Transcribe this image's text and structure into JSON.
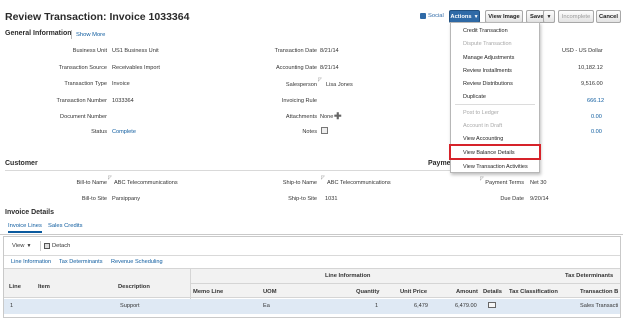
{
  "page": {
    "title": "Review Transaction: Invoice 1033364"
  },
  "header": {
    "social": "Social",
    "actions": "Actions",
    "view_image": "View Image",
    "save": "Save",
    "incomplete": "Incomplete",
    "cancel": "Cancel"
  },
  "general": {
    "title": "General Information",
    "show_more": "Show More",
    "business_unit_label": "Business Unit",
    "business_unit_value": "US1 Business Unit",
    "transaction_source_label": "Transaction Source",
    "transaction_source_value": "Receivables Import",
    "transaction_type_label": "Transaction Type",
    "transaction_type_value": "Invoice",
    "transaction_number_label": "Transaction Number",
    "transaction_number_value": "1033364",
    "document_number_label": "Document Number",
    "status_label": "Status",
    "status_value": "Complete",
    "transaction_date_label": "Transaction Date",
    "transaction_date_value": "8/21/14",
    "accounting_date_label": "Accounting Date",
    "accounting_date_value": "8/21/14",
    "salesperson_label": "Salesperson",
    "salesperson_value": "Lisa Jones",
    "invoicing_rule_label": "Invoicing Rule",
    "attachments_label": "Attachments",
    "attachments_value": "None",
    "notes_label": "Notes",
    "currency_value": "USD - US Dollar",
    "amount_1": "10,182.12",
    "amount_2": "9,516.00",
    "amount_3": "666.12",
    "amount_4": "0.00",
    "amount_5": "0.00"
  },
  "customer": {
    "title": "Customer",
    "bill_to_name_label": "Bill-to Name",
    "bill_to_name_value": "ABC Telecommunications",
    "bill_to_site_label": "Bill-to Site",
    "bill_to_site_value": "Parsippany",
    "ship_to_name_label": "Ship-to Name",
    "ship_to_name_value": "ABC Telecommunications",
    "ship_to_site_label": "Ship-to Site",
    "ship_to_site_value": "1031",
    "payment_title_partial": "Payme",
    "payment_terms_label": "Payment Terms",
    "payment_terms_value": "Net 30",
    "due_date_label": "Due Date",
    "due_date_value": "9/20/14"
  },
  "actions_menu": {
    "items": [
      {
        "label": "Credit Transaction",
        "disabled": false
      },
      {
        "label": "Dispute Transaction",
        "disabled": true
      },
      {
        "label": "Manage Adjustments",
        "disabled": false
      },
      {
        "label": "Review Installments",
        "disabled": false
      },
      {
        "label": "Review Distributions",
        "disabled": false
      },
      {
        "label": "Duplicate",
        "disabled": false
      },
      {
        "label": "Post to Ledger",
        "disabled": true
      },
      {
        "label": "Account in Draft",
        "disabled": true
      },
      {
        "label": "View Accounting",
        "disabled": false
      },
      {
        "label": "View Balance Details",
        "disabled": false,
        "highlighted": true
      },
      {
        "label": "View Transaction Activities",
        "disabled": false
      }
    ]
  },
  "invoice_details": {
    "title": "Invoice Details",
    "tabs": [
      "Invoice Lines",
      "Sales Credits"
    ],
    "view_label": "View",
    "detach_label": "Detach",
    "subtabs": [
      "Line Information",
      "Tax Determinants",
      "Revenue Scheduling"
    ],
    "group_line_information": "Line Information",
    "group_tax_determinants": "Tax Determinants",
    "columns": {
      "line": "Line",
      "item": "Item",
      "description": "Description",
      "memo_line": "Memo Line",
      "uom": "UOM",
      "quantity": "Quantity",
      "unit_price": "Unit Price",
      "amount": "Amount",
      "details": "Details",
      "tax_classification": "Tax Classification",
      "transaction_b": "Transaction B"
    },
    "row": {
      "line": "1",
      "description": "Support",
      "uom": "Ea",
      "quantity": "1",
      "unit_price": "6,479",
      "amount": "6,479.00",
      "transaction_b": "Sales Transacti"
    }
  }
}
